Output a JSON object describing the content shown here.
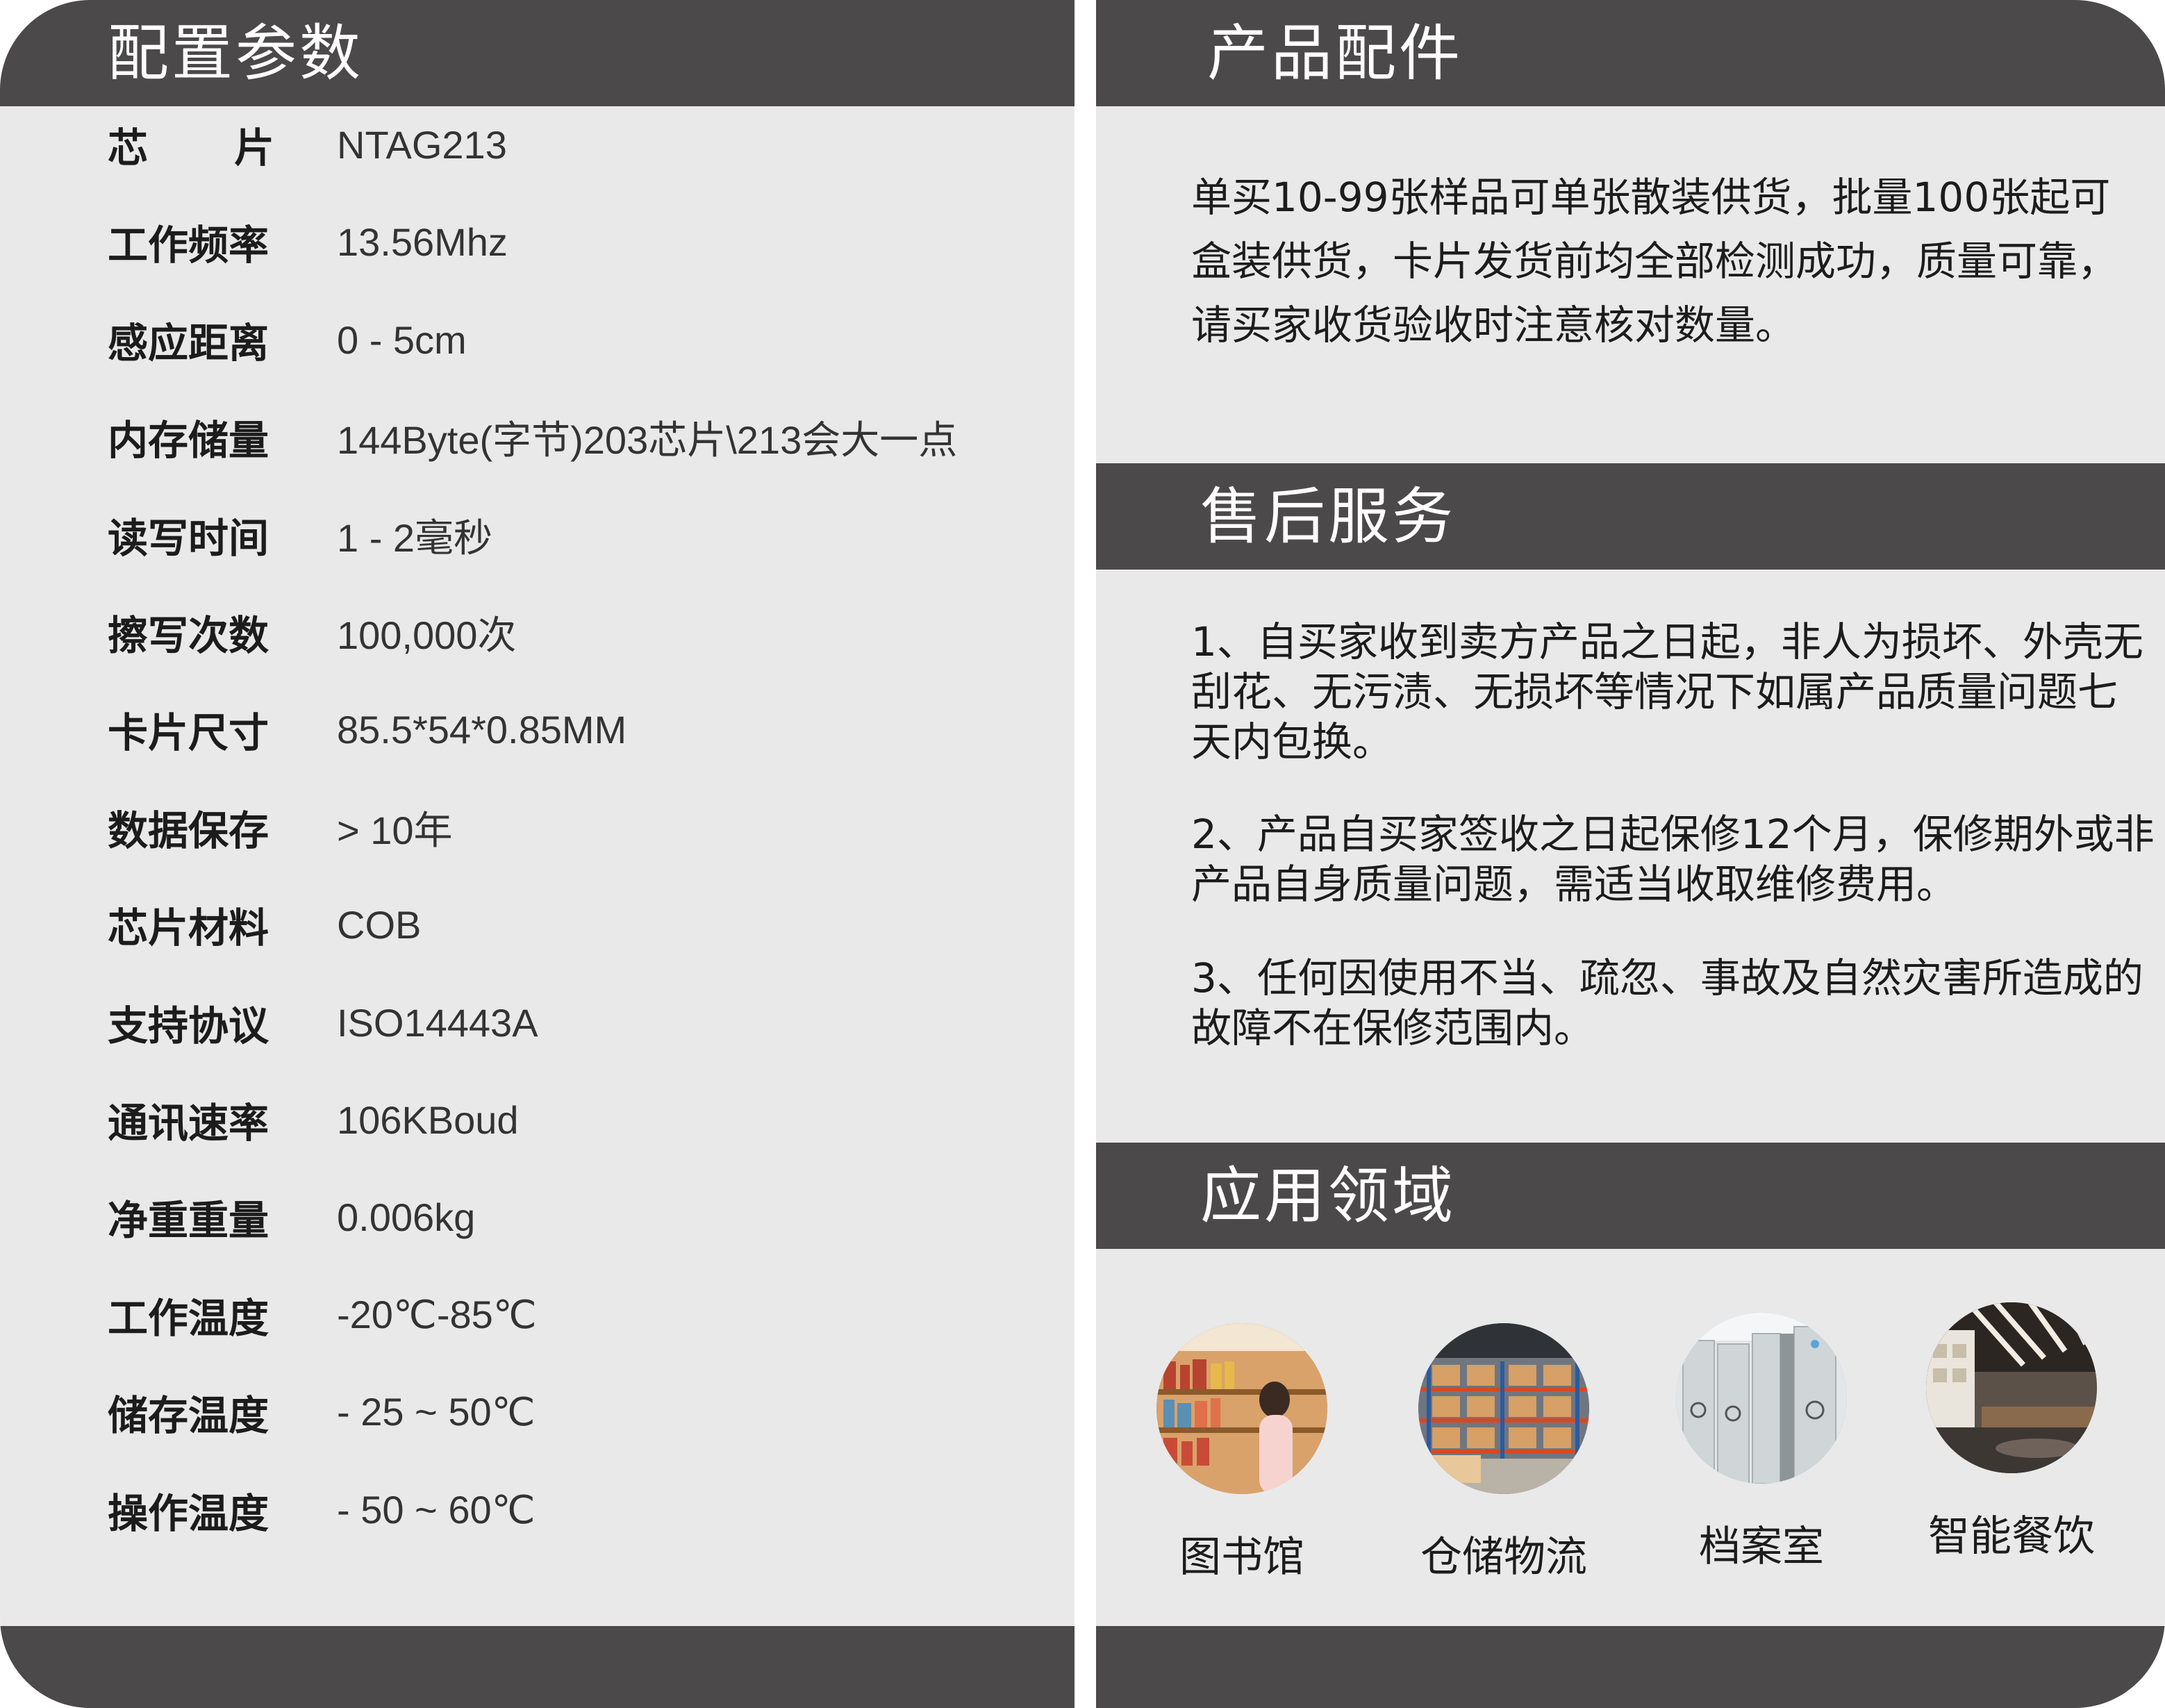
{
  "left": {
    "title": "配置参数",
    "specs": [
      {
        "label": "芯片",
        "value": "NTAG213"
      },
      {
        "label": "工作频率",
        "value": "13.56Mhz"
      },
      {
        "label": "感应距离",
        "value": "0 - 5cm"
      },
      {
        "label": "内存储量",
        "value": "144Byte(字节)203芯片\\213会大一点"
      },
      {
        "label": "读写时间",
        "value": "1 - 2毫秒"
      },
      {
        "label": "擦写次数",
        "value": "100,000次"
      },
      {
        "label": "卡片尺寸",
        "value": "85.5*54*0.85MM"
      },
      {
        "label": "数据保存",
        "value": "> 10年"
      },
      {
        "label": "芯片材料",
        "value": "COB"
      },
      {
        "label": "支持协议",
        "value": "ISO14443A"
      },
      {
        "label": "通讯速率",
        "value": "106KBoud"
      },
      {
        "label": "净重重量",
        "value": "0.006kg"
      },
      {
        "label": "工作温度",
        "value": "-20℃-85℃"
      },
      {
        "label": "储存温度",
        "value": "- 25 ~ 50℃"
      },
      {
        "label": "操作温度",
        "value": "- 50 ~ 60℃"
      }
    ]
  },
  "right": {
    "accessories": {
      "title": "产品配件",
      "text": "单买10-99张样品可单张散装供货，批量100张起可盒装供货，卡片发货前均全部检测成功，质量可靠，请买家收货验收时注意核对数量。"
    },
    "after_sales": {
      "title": "售后服务",
      "items": [
        "1、自买家收到卖方产品之日起，非人为损坏、外壳无刮花、无污渍、无损坏等情况下如属产品质量问题七天内包换。",
        "2、产品自买家签收之日起保修12个月，保修期外或非产品自身质量问题，需适当收取维修费用。",
        "3、任何因使用不当、疏忽、事故及自然灾害所造成的故障不在保修范围内。"
      ]
    },
    "applications": {
      "title": "应用领域",
      "items": [
        {
          "label": "图书馆",
          "icon": "library-photo-icon"
        },
        {
          "label": "仓储物流",
          "icon": "warehouse-photo-icon"
        },
        {
          "label": "档案室",
          "icon": "archive-room-photo-icon"
        },
        {
          "label": "智能餐饮",
          "icon": "smart-dining-photo-icon"
        }
      ]
    }
  }
}
